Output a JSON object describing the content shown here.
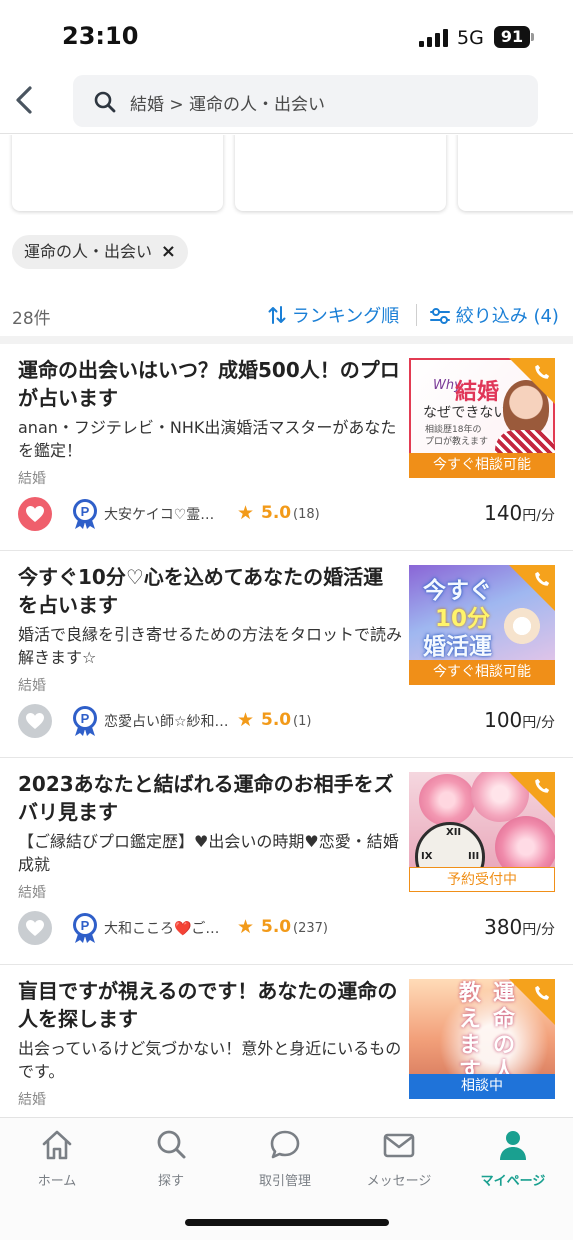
{
  "status_bar": {
    "time": "23:10",
    "network": "5G",
    "battery": "91"
  },
  "header": {
    "search_text": "結婚 > 運命の人・出会い"
  },
  "filter_chip": {
    "label": "運命の人・出会い",
    "remove": "×"
  },
  "results": {
    "count": "28件",
    "sort_label": "ランキング順",
    "filter_label": "絞り込み (4)"
  },
  "items": [
    {
      "title": "運命の出会いはいつ？成婚500人！のプロが占います",
      "desc": "anan・フジテレビ・NHK出演婚活マスターがあなたを鑑定！",
      "category": "結婚",
      "seller": "大安ケイコ♡霊…",
      "rating": "5.0",
      "reviews": "(18)",
      "price": "140",
      "price_unit": "円/分",
      "favorited": true,
      "thumb_tag": "今すぐ相談可能",
      "thumb_text": {
        "a": "なぜ",
        "b": "結婚",
        "c": "できないの？",
        "d": "相談歴18年の",
        "e": "プロが教えます",
        "f": "Why"
      }
    },
    {
      "title": "今すぐ10分♡心を込めてあなたの婚活運を占います",
      "desc": "婚活で良縁を引き寄せるための方法をタロットで読み解きます☆",
      "category": "結婚",
      "seller": "恋愛占い師☆紗和…",
      "rating": "5.0",
      "reviews": "(1)",
      "price": "100",
      "price_unit": "円/分",
      "favorited": false,
      "thumb_tag": "今すぐ相談可能",
      "thumb_text": {
        "a": "今すぐ",
        "b": "10分",
        "c": "婚活運"
      }
    },
    {
      "title": "2023あなたと結ばれる運命のお相手をズバリ見ます",
      "desc": "【ご縁結びプロ鑑定歴】♥出会いの時期♥恋愛・結婚成就",
      "category": "結婚",
      "seller": "大和こころ❤️ご…",
      "rating": "5.0",
      "reviews": "(237)",
      "price": "380",
      "price_unit": "円/分",
      "favorited": false,
      "thumb_tag": "予約受付中"
    },
    {
      "title": "盲目ですが視えるのです！あなたの運命の人を探します",
      "desc": "出会っているけど気づかない！意外と身近にいるものです。",
      "category": "結婚",
      "thumb_tag": "相談中",
      "thumb_text": {
        "a": "運命の人",
        "b": "教えます"
      }
    }
  ],
  "tabs": [
    {
      "label": "ホーム",
      "icon": "home-icon"
    },
    {
      "label": "探す",
      "icon": "search-icon"
    },
    {
      "label": "取引管理",
      "icon": "chat-bubble-icon"
    },
    {
      "label": "メッセージ",
      "icon": "mail-icon"
    },
    {
      "label": "マイページ",
      "icon": "person-icon",
      "active": true
    }
  ],
  "colors": {
    "accent_blue": "#1a7fd6",
    "orange": "#f08f18",
    "teal": "#1aa090",
    "heart_on": "#ef5f6c"
  }
}
